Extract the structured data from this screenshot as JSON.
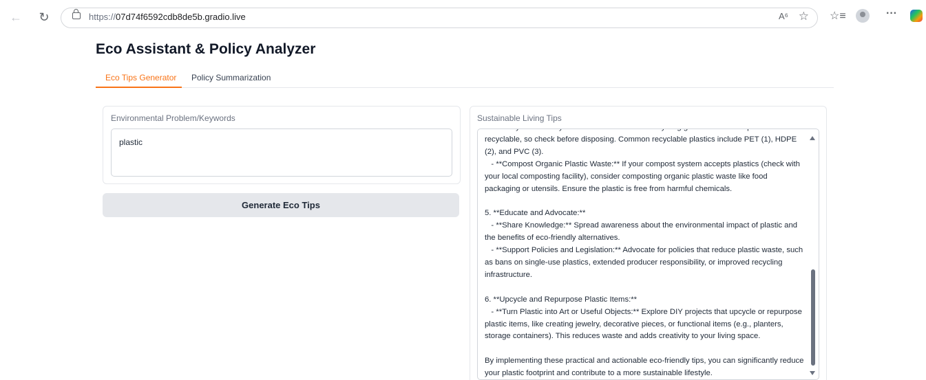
{
  "browser": {
    "scheme": "https://",
    "host": "07d74f6592cdb8de5b.gradio.live"
  },
  "app": {
    "title": "Eco Assistant & Policy Analyzer",
    "tabs": [
      {
        "label": "Eco Tips Generator",
        "active": true
      },
      {
        "label": "Policy Summarization",
        "active": false
      }
    ]
  },
  "input": {
    "label": "Environmental Problem/Keywords",
    "value": "plastic"
  },
  "generate_button": {
    "label": "Generate Eco Tips"
  },
  "output": {
    "label": "Sustainable Living Tips",
    "text": "   - **Recycle Correctly:** Learn and follow local recycling guidelines. Not all plastics are recyclable, so check before disposing. Common recyclable plastics include PET (1), HDPE (2), and PVC (3).\n   - **Compost Organic Plastic Waste:** If your compost system accepts plastics (check with your local composting facility), consider composting organic plastic waste like food packaging or utensils. Ensure the plastic is free from harmful chemicals.\n\n5. **Educate and Advocate:**\n   - **Share Knowledge:** Spread awareness about the environmental impact of plastic and the benefits of eco-friendly alternatives.\n   - **Support Policies and Legislation:** Advocate for policies that reduce plastic waste, such as bans on single-use plastics, extended producer responsibility, or improved recycling infrastructure.\n\n6. **Upcycle and Repurpose Plastic Items:**\n   - **Turn Plastic into Art or Useful Objects:** Explore DIY projects that upcycle or repurpose plastic items, like creating jewelry, decorative pieces, or functional items (e.g., planters, storage containers). This reduces waste and adds creativity to your living space.\n\nBy implementing these practical and actionable eco-friendly tips, you can significantly reduce your plastic footprint and contribute to a more sustainable lifestyle."
  },
  "colors": {
    "accent": "#f97316",
    "button_bg": "#e5e7eb",
    "border": "#e5e7eb"
  }
}
